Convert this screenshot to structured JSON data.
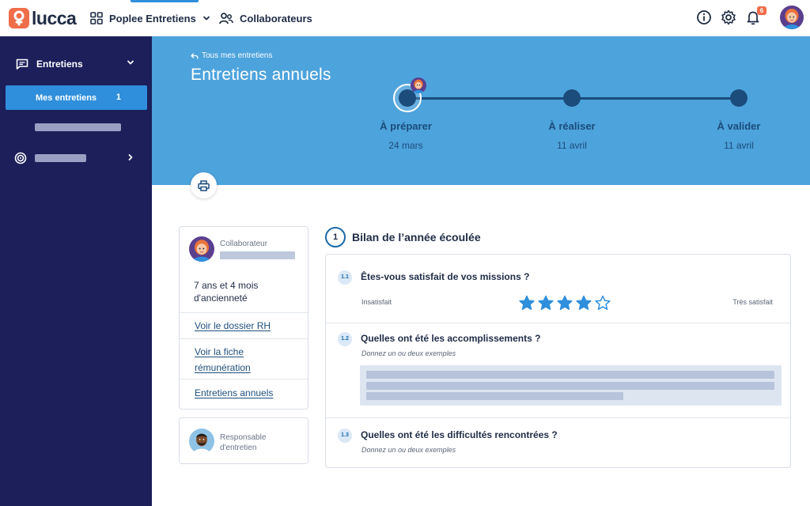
{
  "header": {
    "logo_text": "lucca",
    "app_name": "Poplee Entretiens",
    "collab_link": "Collaborateurs",
    "notification_count": "6",
    "colors": {
      "brand": "#f06d4a",
      "accent": "#2f8fdc",
      "navy": "#1c1f5a"
    }
  },
  "sidebar": {
    "section_label": "Entretiens",
    "active_item": {
      "label": "Mes entretiens",
      "count": "1"
    }
  },
  "hero": {
    "back_link": "Tous mes entretiens",
    "title": "Entretiens annuels",
    "steps": [
      {
        "label": "À préparer",
        "date": "24 mars"
      },
      {
        "label": "À réaliser",
        "date": "11 avril"
      },
      {
        "label": "À valider",
        "date": "11 avril"
      }
    ]
  },
  "collaborator": {
    "role": "Collaborateur",
    "tenure": "7 ans et 4 mois d'ancienneté",
    "links": [
      "Voir le dossier RH",
      "Voir la fiche rémunération",
      "Entretiens annuels"
    ],
    "manager_role": "Responsable d'entretien"
  },
  "section": {
    "number": "1",
    "title": "Bilan de l’année écoulée",
    "questions": [
      {
        "num": "1.1",
        "text": "Êtes-vous satisfait de vos missions ?",
        "scale_min": "Insatisfait",
        "scale_max": "Très satisfait",
        "rating": 4,
        "max_rating": 5
      },
      {
        "num": "1.2",
        "text": "Quelles ont été les accomplissements ?",
        "hint": "Donnez un ou deux exemples"
      },
      {
        "num": "1.3",
        "text": "Quelles ont été les difficultés rencontrées ?",
        "hint": "Donnez un ou deux exemples"
      }
    ]
  }
}
